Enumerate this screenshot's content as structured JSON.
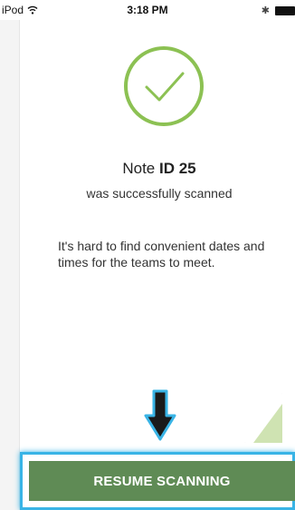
{
  "status_bar": {
    "device": "iPod",
    "wifi_icon": "wifi-icon",
    "time": "3:18 PM",
    "bluetooth_icon": "bluetooth-icon",
    "battery_icon": "battery-icon"
  },
  "confirmation": {
    "icon": "checkmark-circle-icon",
    "icon_color": "#8cc153",
    "note_prefix": "Note",
    "note_id": "ID 25",
    "message": "was successfully scanned"
  },
  "note_card": {
    "text": "It's hard to find convenient dates and times for the teams to meet.",
    "fold_color": "#cfe3b2"
  },
  "annotation": {
    "arrow_icon": "down-arrow-icon",
    "highlight_color": "#39b4e6"
  },
  "resume_button": {
    "label": "RESUME SCANNING",
    "color": "#5f8b55"
  }
}
